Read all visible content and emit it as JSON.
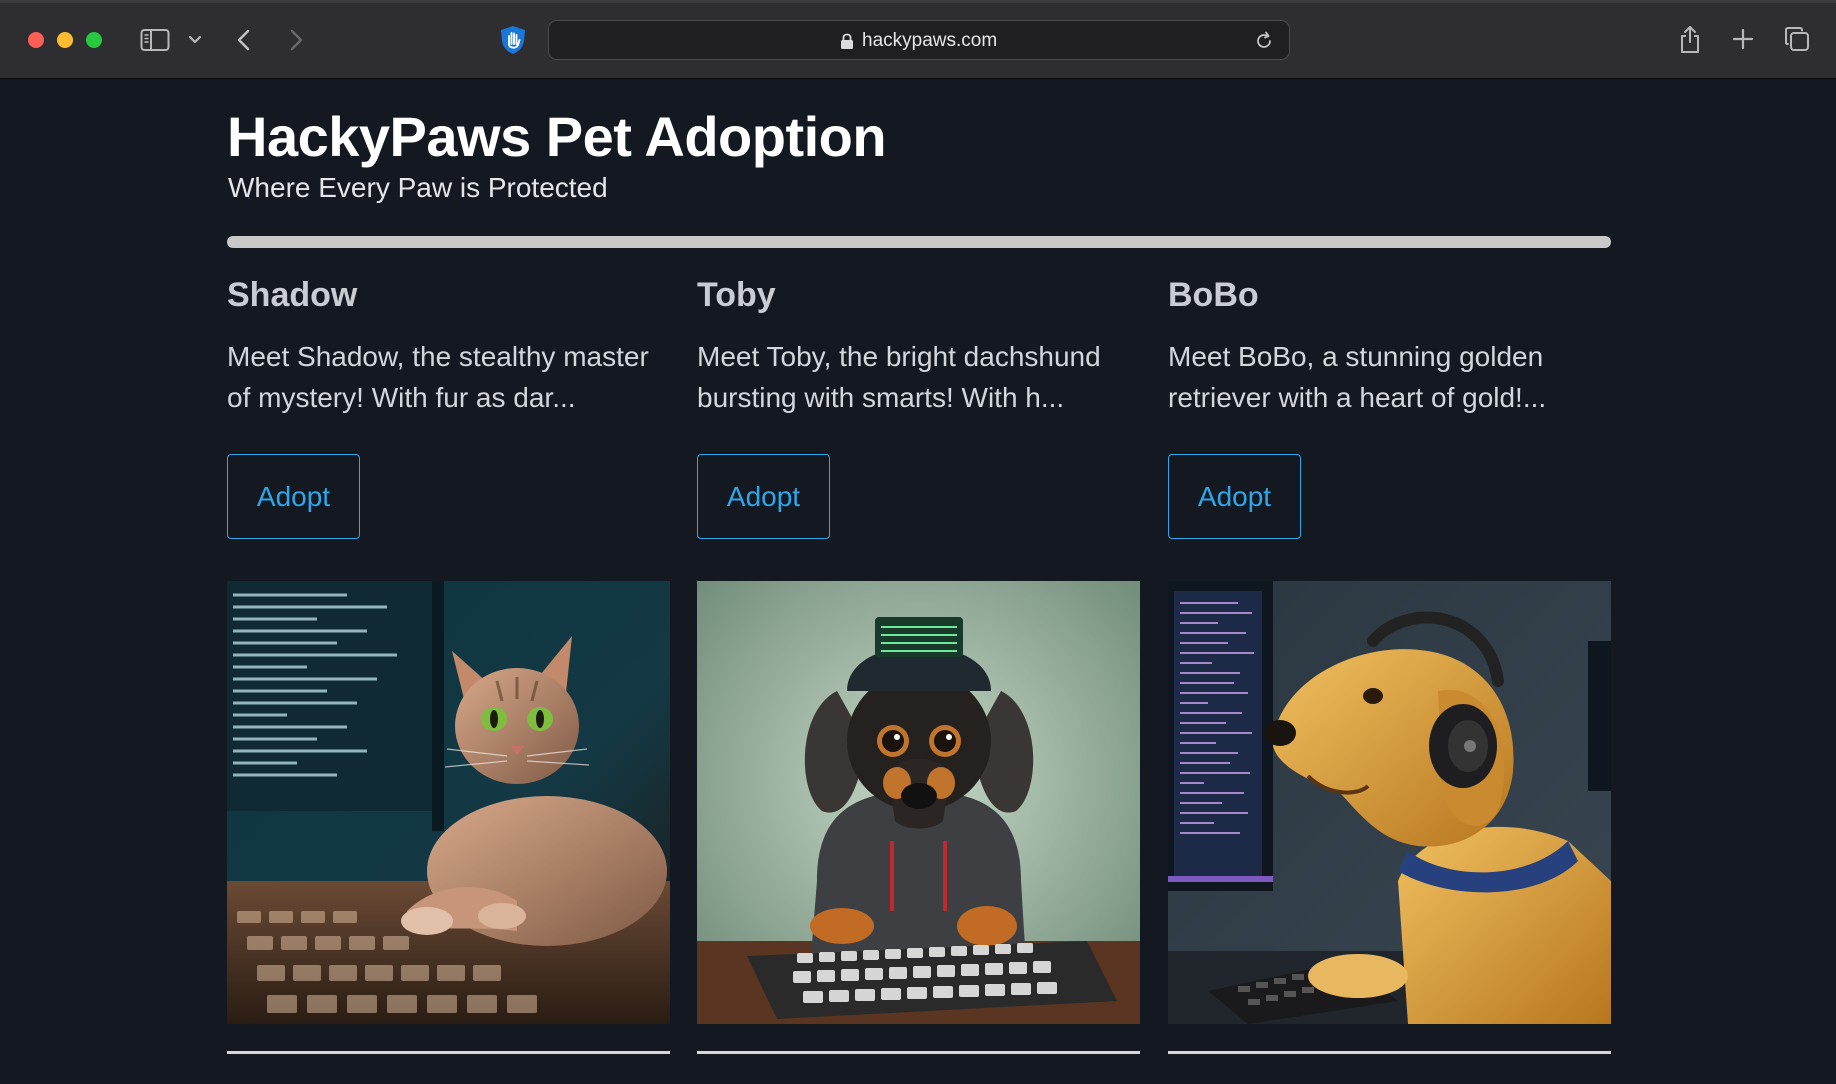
{
  "browser": {
    "url": "hackypaws.com",
    "icons": {
      "sidebar": "sidebar-icon",
      "sidebar_menu": "chevron-down-icon",
      "back": "chevron-left-icon",
      "forward": "chevron-right-icon",
      "privacy": "hand-shield-icon",
      "lock": "lock-icon",
      "reload": "reload-icon",
      "share": "share-icon",
      "new_tab": "plus-icon",
      "tab_overview": "tabs-icon"
    }
  },
  "site": {
    "title": "HackyPaws Pet Adoption",
    "subtitle": "Where Every Paw is Protected"
  },
  "pets": [
    {
      "name": "Shadow",
      "description": "Meet Shadow, the stealthy master of mystery! With fur as dar...",
      "adopt_label": "Adopt"
    },
    {
      "name": "Toby",
      "description": "Meet Toby, the bright dachshund bursting with smarts! With h...",
      "adopt_label": "Adopt"
    },
    {
      "name": "BoBo",
      "description": "Meet BoBo, a stunning golden retriever with a heart of gold!...",
      "adopt_label": "Adopt"
    }
  ],
  "colors": {
    "page_background": "#141821",
    "accent": "#2fa6e8",
    "toolbar": "#2e2e30"
  }
}
